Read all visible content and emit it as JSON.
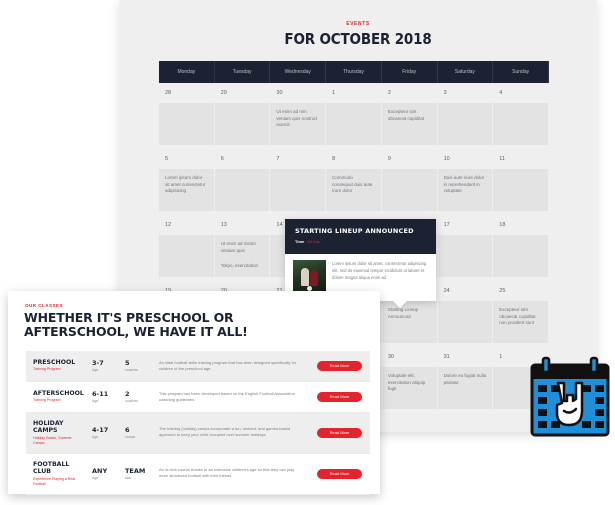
{
  "calendar": {
    "kicker": "EVENTS",
    "title": "FOR OCTOBER 2018",
    "weekdays": [
      "Monday",
      "Tuesday",
      "Wednesday",
      "Thursday",
      "Friday",
      "Saturday",
      "Sunday"
    ],
    "days": [
      {
        "num": "28",
        "text": "",
        "text2": ""
      },
      {
        "num": "29",
        "text": "",
        "text2": ""
      },
      {
        "num": "30",
        "text": "Ut enim ad min veniam quis nostrud exercit",
        "text2": ""
      },
      {
        "num": "1",
        "text": "",
        "text2": ""
      },
      {
        "num": "2",
        "text": "Excepteur sint obcaecat cupiditat",
        "text2": ""
      },
      {
        "num": "3",
        "text": "",
        "text2": ""
      },
      {
        "num": "4",
        "text": "",
        "text2": ""
      },
      {
        "num": "5",
        "text": "Lorem ipsum dolor sit amet consectetur adipisicing",
        "text2": ""
      },
      {
        "num": "6",
        "text": "",
        "text2": ""
      },
      {
        "num": "7",
        "text": "",
        "text2": ""
      },
      {
        "num": "8",
        "text": "Commodo consequat duis aute irure dolor",
        "text2": ""
      },
      {
        "num": "9",
        "text": "",
        "text2": ""
      },
      {
        "num": "10",
        "text": "Duis aute irure dolor in reprehenderit in voluptate",
        "text2": ""
      },
      {
        "num": "11",
        "text": "",
        "text2": ""
      },
      {
        "num": "12",
        "text": "",
        "text2": ""
      },
      {
        "num": "13",
        "text": "Ut enim ad minim veniam quis",
        "text2": "Tokyo, exercitation"
      },
      {
        "num": "14",
        "text": "",
        "text2": ""
      },
      {
        "num": "15",
        "text": "",
        "text2": ""
      },
      {
        "num": "16",
        "text": "",
        "text2": ""
      },
      {
        "num": "17",
        "text": "",
        "text2": ""
      },
      {
        "num": "18",
        "text": "",
        "text2": ""
      },
      {
        "num": "19",
        "text": "",
        "text2": ""
      },
      {
        "num": "20",
        "text": "",
        "text2": ""
      },
      {
        "num": "21",
        "text": "",
        "text2": ""
      },
      {
        "num": "22",
        "text": "",
        "text2": ""
      },
      {
        "num": "23",
        "text": "Starting Lineup Announced",
        "text2": ""
      },
      {
        "num": "24",
        "text": "",
        "text2": ""
      },
      {
        "num": "25",
        "text": "Excepteur sint obcaecat cupiditat non proident sunt",
        "text2": ""
      },
      {
        "num": "26",
        "text": "",
        "text2": ""
      },
      {
        "num": "27",
        "text": "",
        "text2": ""
      },
      {
        "num": "28",
        "text": "",
        "text2": ""
      },
      {
        "num": "29",
        "text": "",
        "text2": ""
      },
      {
        "num": "30",
        "text": "Voluptate elit, exercitation aliquip fugit",
        "text2": ""
      },
      {
        "num": "31",
        "text": "Dolore eu fugiat nulla pariatur",
        "text2": ""
      },
      {
        "num": "1",
        "text": "",
        "text2": ""
      }
    ]
  },
  "popup": {
    "title": "STARTING LINEUP ANNOUNCED",
    "time_label": "Time",
    "time_value": "All Day",
    "description": "Lorem ipsum dolor sit amet, consectetur adipiscing elit, sed do eiusmod tempor incididunt ut labore et dolore magna aliqua enim ad"
  },
  "classes": {
    "kicker": "OUR CLASSES",
    "title": "WHETHER IT'S PRESCHOOL OR AFTERSCHOOL, WE HAVE IT ALL!",
    "age_label": "Age",
    "rows": [
      {
        "name": "PRESCHOOL",
        "sub": "Training Program",
        "age": "3-7",
        "count": "5",
        "count_label": "coaches",
        "desc": "An inital football skills training program that has been designed specifically for children of the preschool age.",
        "button": "Read More"
      },
      {
        "name": "AFTERSCHOOL",
        "sub": "Training Program",
        "age": "6-11",
        "count": "2",
        "count_label": "coaches",
        "desc": "This program has been developed based on the English Football Association coaching guidelines.",
        "button": "Read More"
      },
      {
        "name": "HOLIDAY CAMPS",
        "sub": "Holiday Easter, Summer Camps",
        "age": "4-17",
        "count": "6",
        "count_label": "camps",
        "desc": "The training (holiday) camps incorporate a fun, relaxed, and games-based approach to keep your child occupied over summer holidays.",
        "button": "Read More"
      },
      {
        "name": "FOOTBALL CLUB",
        "sub": "Experience Playing a Real Football",
        "age": "ANY",
        "count": "TEAM",
        "count_label": "kids",
        "desc": "An in-club course thanks to an extensive children's age so that they can play more structured football with their friends.",
        "button": "Read More"
      }
    ]
  },
  "colors": {
    "accent": "#e4232d",
    "navy": "#1b2333",
    "icon_blue": "#1e8fd8"
  },
  "icons": {
    "calendar": "calendar-rock-hand-icon"
  }
}
